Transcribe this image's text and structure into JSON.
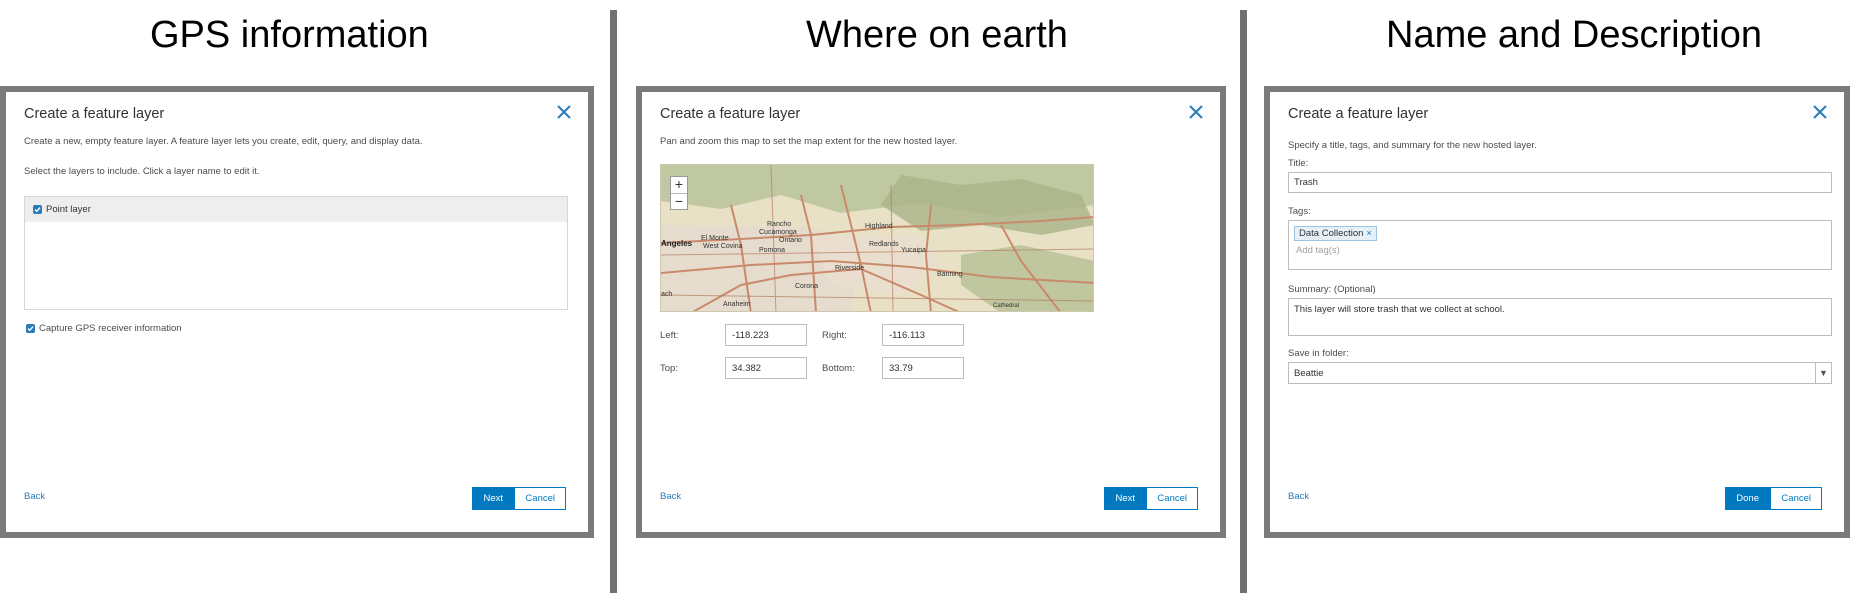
{
  "headings": [
    "GPS information",
    "Where on earth",
    "Name and Description"
  ],
  "colors": {
    "primary": "#0079c1",
    "link": "#2b7bb9",
    "frame": "#7a7a7a"
  },
  "dialog1": {
    "title": "Create a feature layer",
    "desc": "Create a new, empty feature layer. A feature layer lets you create, edit, query, and display data.",
    "instruction": "Select the layers to include. Click a layer name to edit it.",
    "layer": {
      "name": "Point layer",
      "checked": true
    },
    "capture_gps": {
      "label": "Capture GPS receiver information",
      "checked": true
    },
    "back": "Back",
    "next": "Next",
    "cancel": "Cancel"
  },
  "dialog2": {
    "title": "Create a feature layer",
    "desc": "Pan and zoom this map to set the map extent for the new hosted layer.",
    "map": {
      "zoom_in": "+",
      "zoom_out": "−",
      "places": [
        "Rancho",
        "Cucamonga",
        "Highland",
        "Angeles",
        "El Monte",
        "Ontario",
        "Redlands",
        "West Covina",
        "Pomona",
        "Yucaipa",
        "Riverside",
        "Corona",
        "Banning",
        "Anaheim",
        "ach",
        "Cathedral"
      ]
    },
    "left": {
      "label": "Left:",
      "value": "-118.223"
    },
    "right": {
      "label": "Right:",
      "value": "-116.113"
    },
    "top": {
      "label": "Top:",
      "value": "34.382"
    },
    "bottom": {
      "label": "Bottom:",
      "value": "33.79"
    },
    "back": "Back",
    "next": "Next",
    "cancel": "Cancel"
  },
  "dialog3": {
    "title": "Create a feature layer",
    "desc": "Specify a title, tags, and summary for the new hosted layer.",
    "title_label": "Title:",
    "title_value": "Trash",
    "tags_label": "Tags:",
    "tag": "Data Collection",
    "tag_remove": "×",
    "tags_placeholder": "Add tag(s)",
    "summary_label": "Summary: (Optional)",
    "summary_value": "This layer will store trash that we collect at school.",
    "folder_label": "Save in folder:",
    "folder_value": "Beattie",
    "folder_arrow": "▼",
    "back": "Back",
    "done": "Done",
    "cancel": "Cancel"
  }
}
